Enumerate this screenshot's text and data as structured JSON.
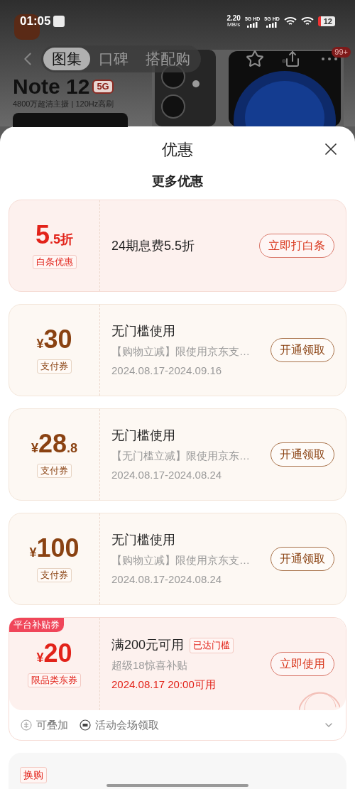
{
  "status_bar": {
    "time": "01:05",
    "speed": "2.20",
    "speed_unit": "MB/s",
    "networks": [
      "5G HD",
      "5G HD"
    ],
    "battery": "12"
  },
  "product_page": {
    "tabs": [
      {
        "label": "图集",
        "selected": true
      },
      {
        "label": "口碑",
        "selected": false
      },
      {
        "label": "搭配购",
        "selected": false
      }
    ],
    "badge": "99+",
    "model": "Note 12",
    "model_tag": "5G",
    "subtitle": "4800万超清主摄 | 120Hz高刷"
  },
  "sheet": {
    "title": "优惠",
    "section": "更多优惠",
    "cards": [
      {
        "kind": "discount",
        "amount": "5",
        "suffix": ".5折",
        "tag": "白条优惠",
        "title": "24期息费5.5折",
        "action": "立即打白条"
      },
      {
        "kind": "coupon",
        "prefix": "¥",
        "amount": "30",
        "tag": "支付券",
        "title": "无门槛使用",
        "desc": "【购物立减】限使用京东支…",
        "date": "2024.08.17-2024.09.16",
        "action": "开通领取"
      },
      {
        "kind": "coupon",
        "prefix": "¥",
        "amount": "28",
        "suffix": ".8",
        "tag": "支付券",
        "title": "无门槛使用",
        "desc": "【无门槛立减】限使用京东…",
        "date": "2024.08.17-2024.08.24",
        "action": "开通领取"
      },
      {
        "kind": "coupon",
        "prefix": "¥",
        "amount": "100",
        "tag": "支付券",
        "title": "无门槛使用",
        "desc": "【购物立减】限使用京东支…",
        "date": "2024.08.17-2024.08.24",
        "action": "开通领取"
      },
      {
        "kind": "platform",
        "ribbon": "平台补贴券",
        "prefix": "¥",
        "amount": "20",
        "tag": "限品类东券",
        "title": "满200元可用",
        "title_badge": "已达门槛",
        "desc": "超级18惊喜补贴",
        "date": "2024.08.17 20:00可用",
        "action": "立即使用",
        "claimed": true,
        "footer": [
          "可叠加",
          "活动会场领取"
        ]
      }
    ],
    "next_card": {
      "tag": "换购"
    }
  }
}
